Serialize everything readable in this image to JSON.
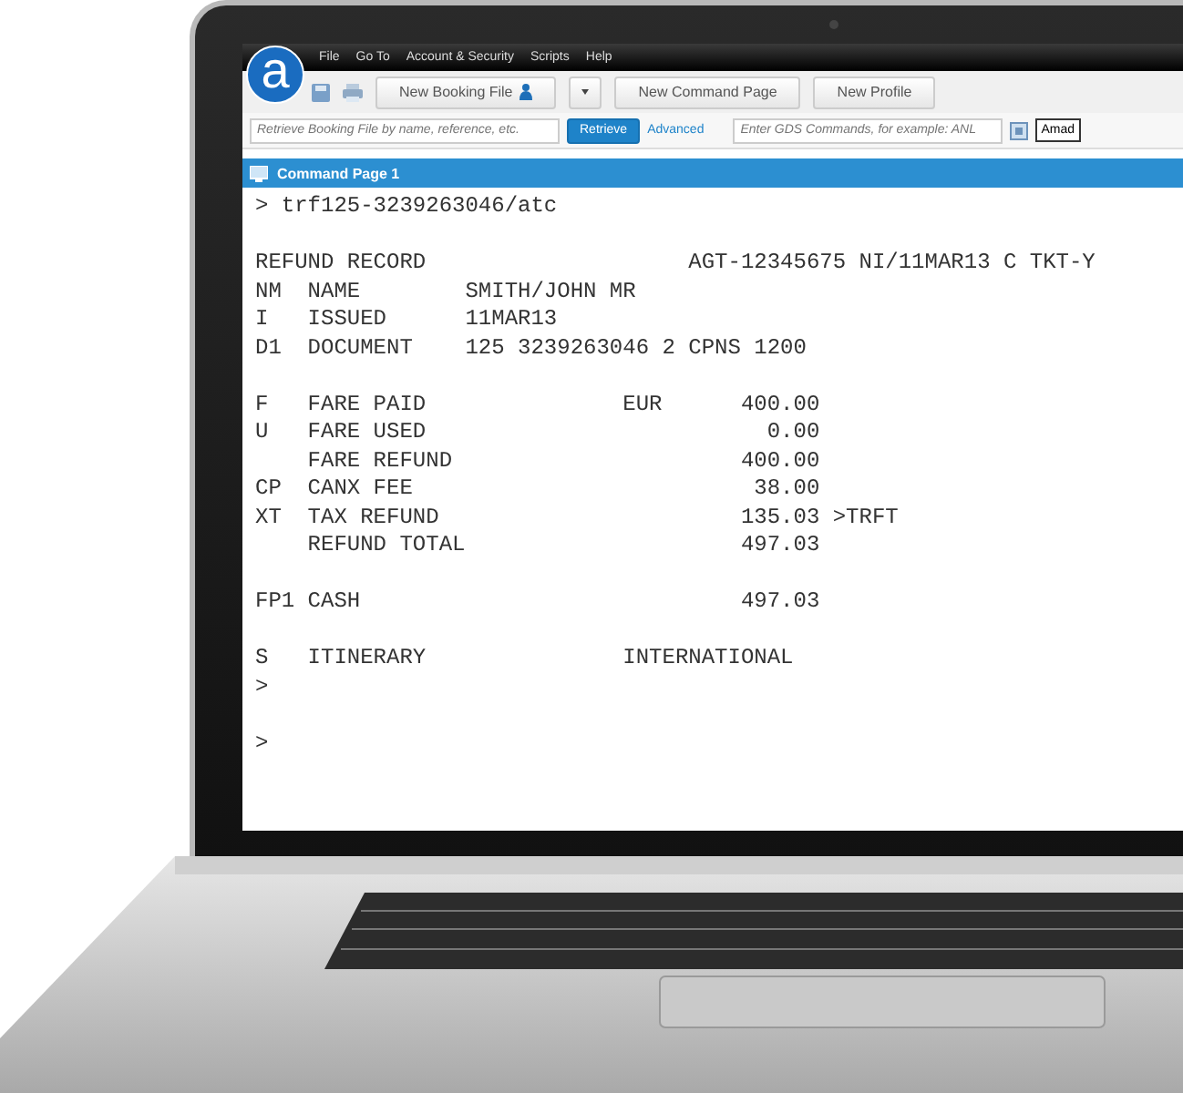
{
  "app": {
    "logo": "a",
    "menu": [
      "File",
      "Go To",
      "Account & Security",
      "Scripts",
      "Help"
    ],
    "toolbar": [
      {
        "kind": "split",
        "label": "New Booking File"
      },
      {
        "kind": "plain",
        "label": "New Command Page"
      },
      {
        "kind": "plain",
        "label": "New Profile"
      }
    ],
    "search": {
      "booking_placeholder": "Retrieve Booking File by name, reference, etc.",
      "retrieve_button": "Retrieve",
      "advanced_link": "Advanced",
      "command_placeholder": "Enter GDS Commands, for example: ANL",
      "system_select": "Amad"
    },
    "command_page": {
      "title": "Command Page 1",
      "blocks": [
        [
          "> trf125-3239263046/atc"
        ],
        [
          "REFUND RECORD                    AGT-12345675 NI/11MAR13 C TKT-Y",
          "NM  NAME        SMITH/JOHN MR",
          "I   ISSUED      11MAR13",
          "D1  DOCUMENT    125 3239263046 2 CPNS 1200"
        ],
        [
          "F   FARE PAID               EUR      400.00",
          "U   FARE USED                          0.00",
          "    FARE REFUND                      400.00",
          "CP  CANX FEE                          38.00",
          "XT  TAX REFUND                       135.03 >TRFT",
          "    REFUND TOTAL                     497.03"
        ],
        [
          "FP1 CASH                             497.03"
        ],
        [
          "S   ITINERARY               INTERNATIONAL",
          ">"
        ],
        [
          ">"
        ]
      ]
    }
  }
}
